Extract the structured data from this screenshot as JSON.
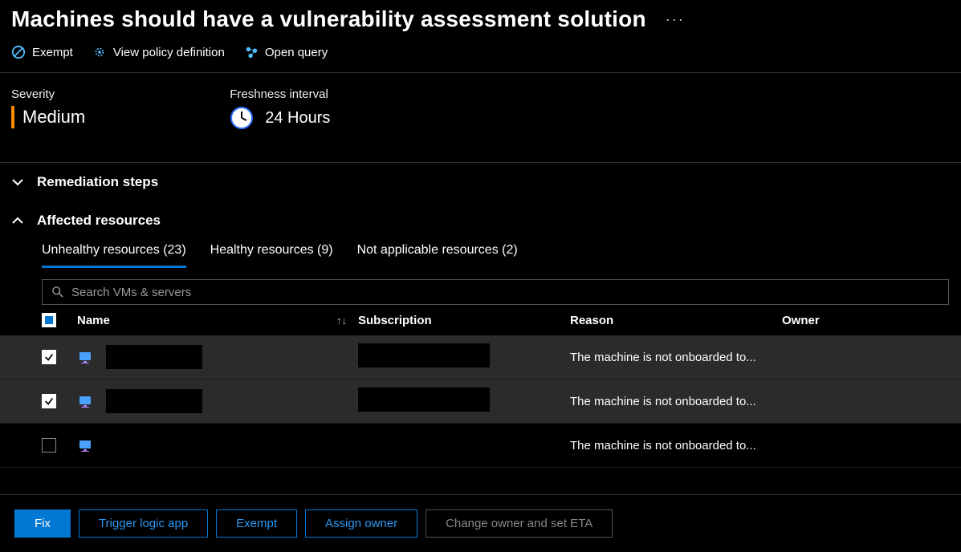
{
  "header": {
    "title": "Machines should have a vulnerability assessment solution"
  },
  "toolbar": {
    "exempt": "Exempt",
    "view_policy": "View policy definition",
    "open_query": "Open query"
  },
  "info": {
    "severity_label": "Severity",
    "severity_value": "Medium",
    "freshness_label": "Freshness interval",
    "freshness_value": "24 Hours"
  },
  "sections": {
    "remediation": "Remediation steps",
    "affected": "Affected resources"
  },
  "tabs": {
    "unhealthy": "Unhealthy resources (23)",
    "healthy": "Healthy resources (9)",
    "notapplicable": "Not applicable resources (2)"
  },
  "search": {
    "placeholder": "Search VMs & servers"
  },
  "columns": {
    "name": "Name",
    "subscription": "Subscription",
    "reason": "Reason",
    "owner": "Owner"
  },
  "rows": [
    {
      "checked": true,
      "reason": "The machine is not onboarded to..."
    },
    {
      "checked": true,
      "reason": "The machine is not onboarded to..."
    },
    {
      "checked": false,
      "reason": "The machine is not onboarded to..."
    }
  ],
  "actions": {
    "fix": "Fix",
    "trigger": "Trigger logic app",
    "exempt": "Exempt",
    "assign": "Assign owner",
    "change": "Change owner and set ETA"
  }
}
